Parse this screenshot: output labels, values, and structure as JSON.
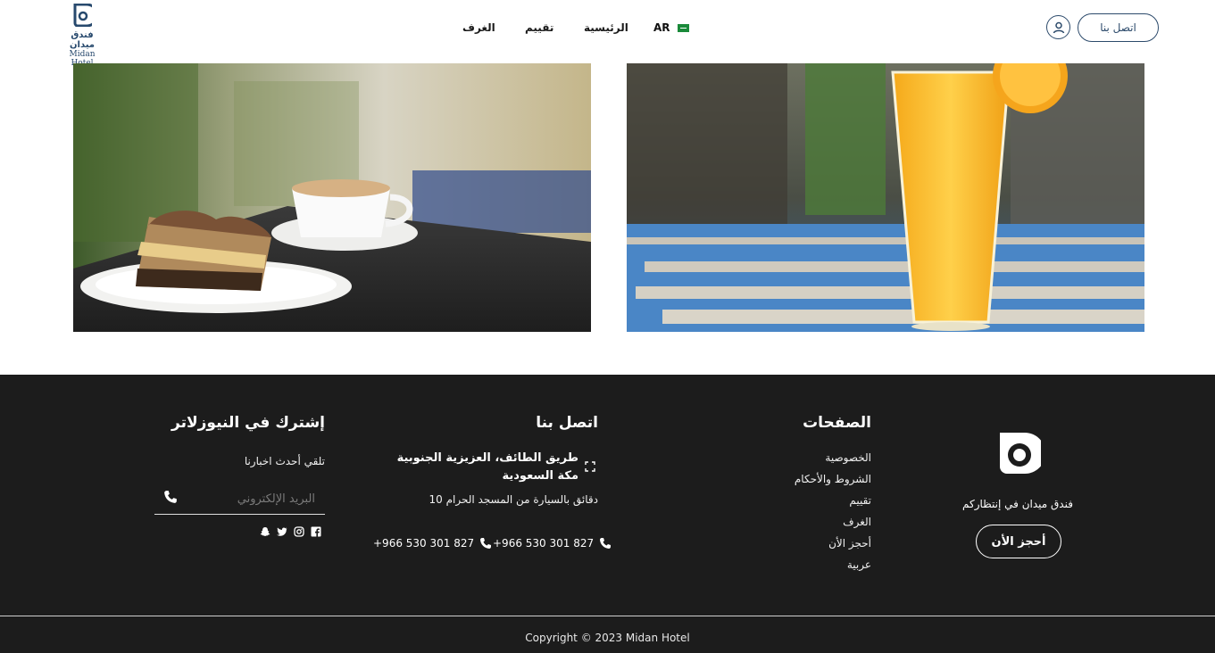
{
  "header": {
    "logo_ar": "فندق ميدان",
    "logo_en": "Midan Hotel",
    "nav": [
      {
        "label": "الغرف"
      },
      {
        "label": "تقييم"
      },
      {
        "label": "الرئيسية"
      }
    ],
    "language": "AR",
    "contact_button": "اتصل بنا"
  },
  "footer": {
    "brand_tagline": "فندق ميدان في إنتظاركم",
    "book_button": "أحجز الأن",
    "pages_heading": "الصفحات",
    "pages": [
      "الخصوصية",
      "الشروط والأحكام",
      "تقييم",
      "الغرف",
      "أحجز الأن",
      "عربية"
    ],
    "contact_heading": "اتصل بنا",
    "address": "طريق الطائف، العزيزية الجنوبية مكة السعودية",
    "distance_note": "10 دقائق بالسيارة من المسجد الحرام",
    "phone_1": "+966 530 301 827",
    "phone_2": "+966 530 301 827",
    "newsletter_heading": "إشترك في النيوزلاتر",
    "newsletter_sub": "تلقي أحدث اخبارنا",
    "email_placeholder": "البريد الإلكتروني",
    "copyright": "Copyright © 2023 Midan Hotel"
  },
  "colors": {
    "brand": "#2c4a6b",
    "footer_bg": "#1c1c1c"
  }
}
